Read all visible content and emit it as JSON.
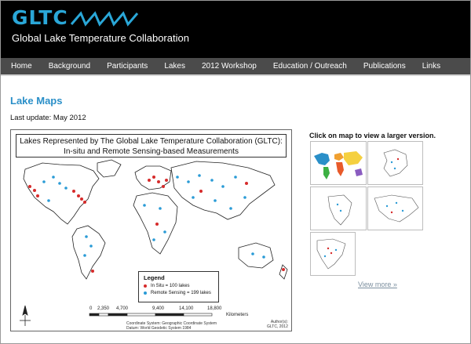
{
  "site": {
    "logo": "GLTC",
    "tagline": "Global Lake Temperature Collaboration",
    "accent": "#2aa7d8",
    "header_bg": "#000000",
    "nav_bg": "#4b4b4b"
  },
  "nav": [
    {
      "label": "Home"
    },
    {
      "label": "Background"
    },
    {
      "label": "Participants"
    },
    {
      "label": "Lakes"
    },
    {
      "label": "2012 Workshop"
    },
    {
      "label": "Education / Outreach"
    },
    {
      "label": "Publications"
    },
    {
      "label": "Links"
    }
  ],
  "page": {
    "title": "Lake Maps",
    "last_update": "Last update: May 2012"
  },
  "map": {
    "title_line1": "Lakes Represented by The Global Lake Temperature Collaboration (GLTC):",
    "title_line2": "In-situ and Remote Sensing-based Measurements",
    "legend": {
      "title": "Legend",
      "insitu": "In Situ = 100 lakes",
      "remote": "Remote Sensing = 199 lakes",
      "insitu_color": "#d62b2b",
      "remote_color": "#2a9bd6"
    },
    "scale": {
      "ticks": [
        "0",
        "2,350",
        "4,700",
        "9,400",
        "14,100",
        "18,800"
      ],
      "unit": "Kilometers"
    },
    "coordinate_system": "Coordinate System: Geographic Coordinate System",
    "datum": "Datum: World Geodetic System 1984",
    "author_label": "Author(s):",
    "author": "GLTC, 2012"
  },
  "sidebar": {
    "heading": "Click on map to view a larger version.",
    "thumbnails": [
      {
        "icon": "world-colored-map-thumbnail"
      },
      {
        "icon": "europe-map-thumbnail"
      },
      {
        "icon": "africa-map-thumbnail"
      },
      {
        "icon": "asia-map-thumbnail"
      },
      {
        "icon": "north-america-map-thumbnail"
      }
    ],
    "view_more": "View more »"
  }
}
